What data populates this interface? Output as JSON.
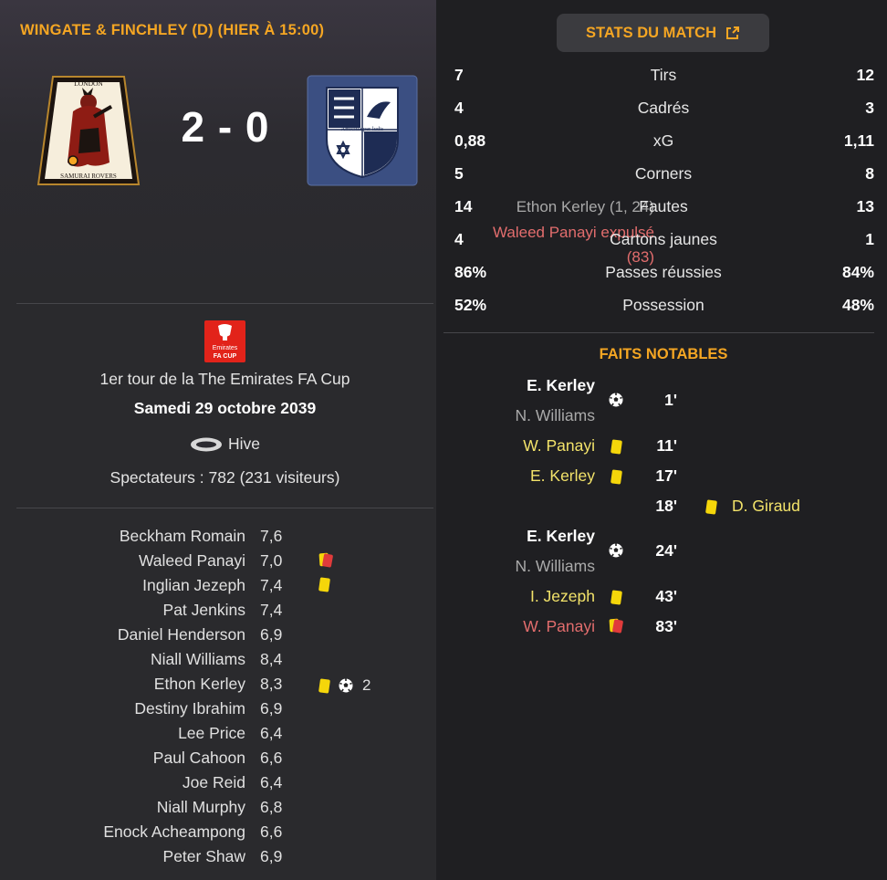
{
  "match": {
    "header": "WINGATE & FINCHLEY (D) (HIER À 15:00)",
    "score": "2 - 0",
    "home_crest_text_top": "LONDON",
    "home_crest_text_bottom": "SAMURAI ROVERS",
    "away_crest_text": "Amicitia per ludis",
    "home_scorers": "Ethon Kerley (1, 24)",
    "red_card_line1": "Waleed Panayi expulsé",
    "red_card_line2": "(83)",
    "competition_logo_text_top": "Emirates",
    "competition_logo_text_bottom": "FA CUP",
    "competition": "1er tour de la The Emirates FA Cup",
    "date": "Samedi 29 octobre 2039",
    "venue": "Hive",
    "attendance": "Spectateurs : 782 (231 visiteurs)"
  },
  "players": [
    {
      "name": "Beckham Romain",
      "rating": "7,6",
      "icons": []
    },
    {
      "name": "Waleed Panayi",
      "rating": "7,0",
      "icons": [
        "double-card"
      ]
    },
    {
      "name": "Inglian Jezeph",
      "rating": "7,4",
      "icons": [
        "yellow-card"
      ]
    },
    {
      "name": "Pat Jenkins",
      "rating": "7,4",
      "icons": []
    },
    {
      "name": "Daniel Henderson",
      "rating": "6,9",
      "icons": []
    },
    {
      "name": "Niall Williams",
      "rating": "8,4",
      "icons": []
    },
    {
      "name": "Ethon Kerley",
      "rating": "8,3",
      "icons": [
        "yellow-card",
        "ball"
      ],
      "goals": "2"
    },
    {
      "name": "Destiny Ibrahim",
      "rating": "6,9",
      "icons": []
    },
    {
      "name": "Lee Price",
      "rating": "6,4",
      "icons": []
    },
    {
      "name": "Paul Cahoon",
      "rating": "6,6",
      "icons": []
    },
    {
      "name": "Joe Reid",
      "rating": "6,4",
      "icons": []
    },
    {
      "name": "Niall Murphy",
      "rating": "6,8",
      "icons": []
    },
    {
      "name": "Enock Acheampong",
      "rating": "6,6",
      "icons": []
    },
    {
      "name": "Peter Shaw",
      "rating": "6,9",
      "icons": []
    }
  ],
  "stats_button": "STATS DU MATCH",
  "stats": [
    {
      "label": "Tirs",
      "home": "7",
      "away": "12"
    },
    {
      "label": "Cadrés",
      "home": "4",
      "away": "3"
    },
    {
      "label": "xG",
      "home": "0,88",
      "away": "1,11"
    },
    {
      "label": "Corners",
      "home": "5",
      "away": "8"
    },
    {
      "label": "Fautes",
      "home": "14",
      "away": "13"
    },
    {
      "label": "Cartons jaunes",
      "home": "4",
      "away": "1"
    },
    {
      "label": "Passes réussies",
      "home": "86%",
      "away": "84%"
    },
    {
      "label": "Possession",
      "home": "52%",
      "away": "48%"
    }
  ],
  "facts_title": "FAITS NOTABLES",
  "events": [
    {
      "side": "home",
      "type": "goal",
      "player": "E. Kerley",
      "assist": "N. Williams",
      "minute": "1'"
    },
    {
      "side": "home",
      "type": "yellow",
      "player": "W. Panayi",
      "minute": "11'"
    },
    {
      "side": "home",
      "type": "yellow",
      "player": "E. Kerley",
      "minute": "17'"
    },
    {
      "side": "away",
      "type": "yellow",
      "player": "D. Giraud",
      "minute": "18'"
    },
    {
      "side": "home",
      "type": "goal",
      "player": "E. Kerley",
      "assist": "N. Williams",
      "minute": "24'"
    },
    {
      "side": "home",
      "type": "yellow",
      "player": "I. Jezeph",
      "minute": "43'"
    },
    {
      "side": "home",
      "type": "second-yellow-red",
      "player": "W. Panayi",
      "minute": "83'"
    }
  ],
  "colors": {
    "accent": "#f5a623",
    "yellow_card": "#f5d60a",
    "red_card": "#e03b3b",
    "red_text": "#e26d6d",
    "yellow_text": "#f3e36a"
  }
}
